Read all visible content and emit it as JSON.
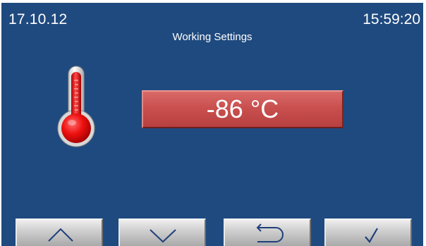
{
  "status": {
    "date": "17.10.12",
    "time": "15:59:20"
  },
  "screen": {
    "title": "Working Settings"
  },
  "temperature": {
    "display": "-86 °C",
    "indicator_icon": "thermometer-icon"
  },
  "buttons": [
    {
      "name": "up-button",
      "icon": "chevron-up-icon"
    },
    {
      "name": "down-button",
      "icon": "chevron-down-icon"
    },
    {
      "name": "back-button",
      "icon": "return-arrow-icon"
    },
    {
      "name": "confirm-button",
      "icon": "checkmark-icon"
    }
  ],
  "colors": {
    "background": "#1f4a7f",
    "value_box": "#c9504f",
    "button": "#c8c8c8"
  }
}
